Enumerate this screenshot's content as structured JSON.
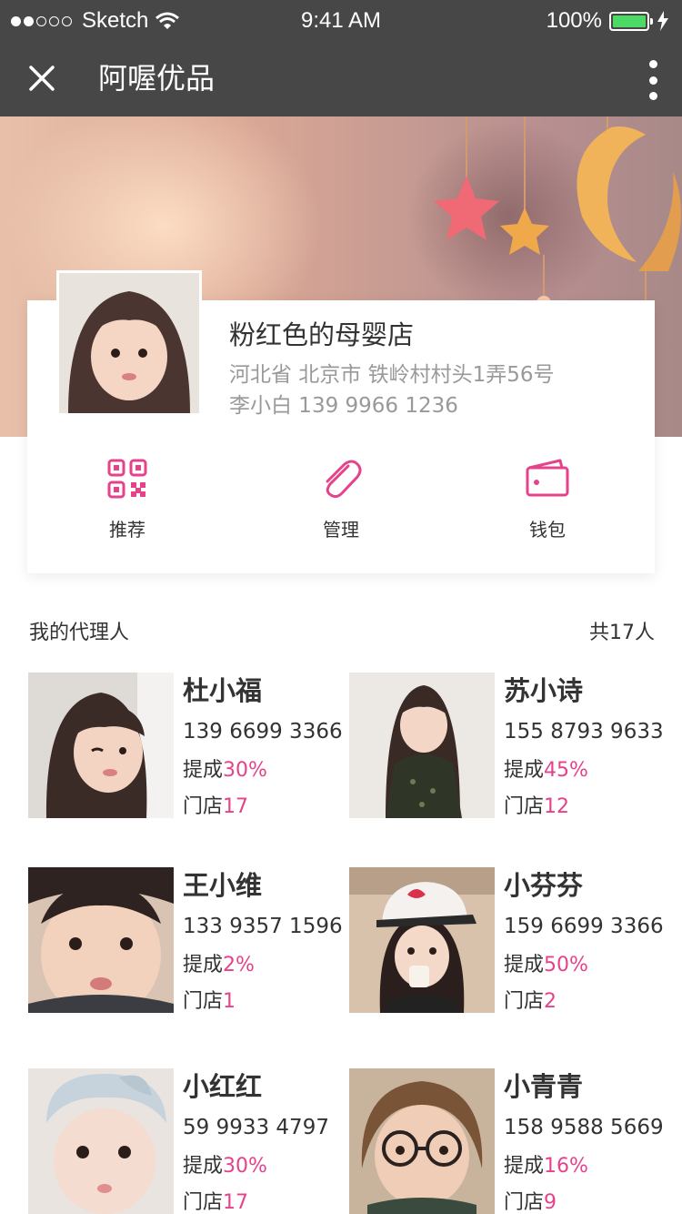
{
  "status_bar": {
    "carrier": "Sketch",
    "time": "9:41 AM",
    "battery": "100%"
  },
  "nav": {
    "title": "阿喔优品"
  },
  "shop": {
    "name": "粉红色的母婴店",
    "address": "河北省 北京市 铁岭村村头1弄56号",
    "contact": "李小白 139 9966 1236"
  },
  "actions": [
    {
      "label": "推荐",
      "icon": "qr-code-icon"
    },
    {
      "label": "管理",
      "icon": "paperclip-icon"
    },
    {
      "label": "钱包",
      "icon": "wallet-icon"
    }
  ],
  "agents_section": {
    "title": "我的代理人",
    "count": "共17人"
  },
  "agents": [
    {
      "name": "杜小福",
      "phone": "139 6699 3366",
      "commission_label": "提成",
      "commission": "30%",
      "stores_label": "门店",
      "stores": "17"
    },
    {
      "name": "苏小诗",
      "phone": "155 8793 9633",
      "commission_label": "提成",
      "commission": "45%",
      "stores_label": "门店",
      "stores": "12"
    },
    {
      "name": "王小维",
      "phone": "133 9357 1596",
      "commission_label": "提成",
      "commission": "2%",
      "stores_label": "门店",
      "stores": "1"
    },
    {
      "name": "小芬芬",
      "phone": "159 6699 3366",
      "commission_label": "提成",
      "commission": "50%",
      "stores_label": "门店",
      "stores": "2"
    },
    {
      "name": "小红红",
      "phone": "59 9933 4797",
      "commission_label": "提成",
      "commission": "30%",
      "stores_label": "门店",
      "stores": "17"
    },
    {
      "name": "小青青",
      "phone": "158 9588 5669",
      "commission_label": "提成",
      "commission": "16%",
      "stores_label": "门店",
      "stores": "9"
    }
  ],
  "colors": {
    "accent": "#e6428b",
    "nav_bg": "#474747",
    "battery": "#4cd964"
  }
}
